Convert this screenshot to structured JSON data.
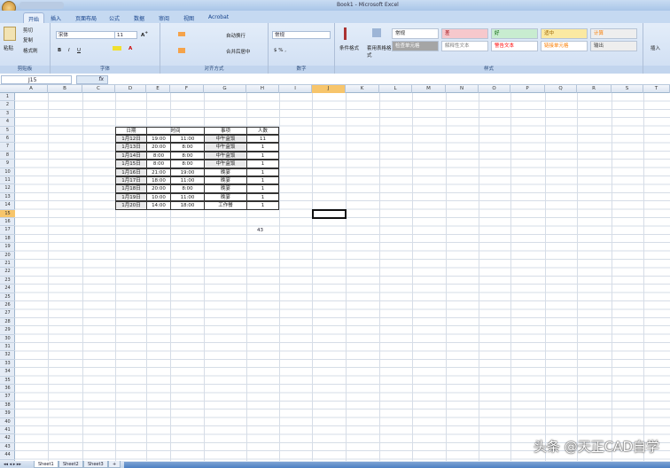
{
  "window": {
    "title": "Book1 - Microsoft Excel"
  },
  "ribbon": {
    "tabs": [
      "开始",
      "插入",
      "页面布局",
      "公式",
      "数据",
      "审阅",
      "视图",
      "Acrobat"
    ],
    "clipboard": {
      "paste": "粘贴",
      "cut": "剪切",
      "copy": "复制",
      "format_painter": "格式刷",
      "label": "剪贴板"
    },
    "font": {
      "name": "宋体",
      "size": "11",
      "label": "字体"
    },
    "alignment": {
      "wrap": "自动换行",
      "merge": "合并后居中",
      "label": "对齐方式"
    },
    "number": {
      "format": "常规",
      "label": "数字"
    },
    "styles": {
      "conditional": "条件格式",
      "table": "套用表格格式",
      "label": "样式",
      "items": [
        {
          "name": "常规",
          "bg": "#ffffff",
          "fg": "#222222"
        },
        {
          "name": "差",
          "bg": "#f6c8cc",
          "fg": "#9c0006"
        },
        {
          "name": "好",
          "bg": "#c8ecd0",
          "fg": "#006100"
        },
        {
          "name": "适中",
          "bg": "#fbe9a2",
          "fg": "#9c6500"
        },
        {
          "name": "计算",
          "bg": "#eeeeee",
          "fg": "#fa7d00"
        },
        {
          "name": "检查单元格",
          "bg": "#a5a5a5",
          "fg": "#ffffff"
        },
        {
          "name": "解释性文本",
          "bg": "#ffffff",
          "fg": "#7f7f7f"
        },
        {
          "name": "警告文本",
          "bg": "#ffffff",
          "fg": "#ff0000"
        },
        {
          "name": "链接单元格",
          "bg": "#ffffff",
          "fg": "#fa7d00"
        },
        {
          "name": "输出",
          "bg": "#eeeeee",
          "fg": "#3f3f3f"
        }
      ]
    },
    "cells": {
      "insert": "插入"
    }
  },
  "formula_bar": {
    "name_box": "J15",
    "fx": "fx",
    "value": ""
  },
  "columns": [
    "A",
    "B",
    "C",
    "D",
    "E",
    "F",
    "G",
    "H",
    "I",
    "J",
    "K",
    "L",
    "M",
    "N",
    "O",
    "P",
    "Q",
    "R",
    "S",
    "T"
  ],
  "rows": [
    "1",
    "2",
    "3",
    "4",
    "5",
    "6",
    "7",
    "8",
    "9",
    "10",
    "11",
    "12",
    "13",
    "14",
    "15",
    "16",
    "17",
    "18",
    "19",
    "20",
    "21",
    "22",
    "23",
    "24",
    "25",
    "26",
    "27",
    "28",
    "29",
    "30",
    "31",
    "32",
    "33",
    "34",
    "35",
    "36",
    "37",
    "38",
    "39",
    "40",
    "41",
    "42",
    "43",
    "44"
  ],
  "table": {
    "headers": [
      "日期",
      "时间",
      "事项",
      "人数"
    ],
    "rows": [
      [
        "1月12日",
        "19:00",
        "11:00",
        "中午盒饭",
        "11"
      ],
      [
        "1月13日",
        "20:00",
        "8:00",
        "中午盒饭",
        "1"
      ],
      [
        "1月14日",
        "8:00",
        "8:00",
        "中午盒饭",
        "1"
      ],
      [
        "1月15日",
        "8:00",
        "8:00",
        "中午盒饭",
        "1"
      ],
      [
        "1月16日",
        "21:00",
        "19:00",
        "晚宴",
        "1"
      ],
      [
        "1月17日",
        "18:00",
        "11:00",
        "晚宴",
        "1"
      ],
      [
        "1月18日",
        "20:00",
        "8:00",
        "晚宴",
        "1"
      ],
      [
        "1月19日",
        "10:00",
        "11:00",
        "晚宴",
        "1"
      ],
      [
        "1月20日",
        "14:00",
        "18:00",
        "工作餐",
        "1"
      ]
    ],
    "total": "43"
  },
  "sheets": [
    "Sheet1",
    "Sheet2",
    "Sheet3"
  ],
  "watermark": "头条 @天正CAD自学"
}
